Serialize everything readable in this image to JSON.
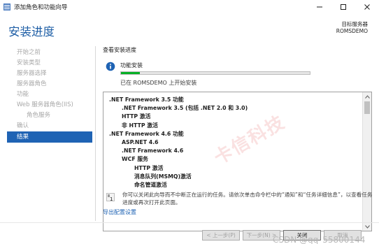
{
  "window": {
    "title": "添加角色和功能向导",
    "controls": [
      "minimize",
      "maximize",
      "close"
    ]
  },
  "header": {
    "page_title": "安装进度",
    "destination_label": "目标服务器",
    "destination_server": "ROMSDEMO"
  },
  "nav": {
    "items": [
      {
        "label": "开始之前",
        "state": "disabled"
      },
      {
        "label": "安装类型",
        "state": "disabled"
      },
      {
        "label": "服务器选择",
        "state": "disabled"
      },
      {
        "label": "服务器角色",
        "state": "disabled"
      },
      {
        "label": "功能",
        "state": "disabled"
      },
      {
        "label": "Web 服务器角色(IIS)",
        "state": "disabled"
      },
      {
        "label": "角色服务",
        "state": "disabled",
        "sub": true
      },
      {
        "label": "确认",
        "state": "disabled"
      },
      {
        "label": "结果",
        "state": "active"
      }
    ]
  },
  "main": {
    "section_label": "查看安装进度",
    "info_icon": "info-icon",
    "info_title": "功能安装",
    "progress": 0.1,
    "progress_status": "已在 ROMSDEMO 上开始安装",
    "features": [
      {
        "text": ".NET Framework 3.5 功能",
        "level": 0
      },
      {
        "text": ".NET Framework 3.5 (包括 .NET 2.0 和 3.0)",
        "level": 1
      },
      {
        "text": "HTTP 激活",
        "level": 1
      },
      {
        "text": "非 HTTP 激活",
        "level": 1
      },
      {
        "text": ".NET Framework 4.6 功能",
        "level": 0
      },
      {
        "text": "ASP.NET 4.6",
        "level": 1
      },
      {
        "text": ".NET Framework 4.6",
        "level": 1
      },
      {
        "text": "WCF 服务",
        "level": 1
      },
      {
        "text": "HTTP 激活",
        "level": 2
      },
      {
        "text": "消息队列(MSMQ)激活",
        "level": 2
      },
      {
        "text": "命名管道激活",
        "level": 2
      }
    ],
    "notice_number": "1",
    "notice_text": "你可以关闭此向导而不中断正在运行的任务。请依次单击命令栏中的“通知”和“任务详细信息”，以查看任务进度或再次打开此页面。",
    "export_link": "导出配置设置"
  },
  "buttons": {
    "prev": "< 上一步(P)",
    "next": "下一步(N) >",
    "close": "关闭",
    "cancel": "取消"
  },
  "watermark": "CSDN @qq_55800144",
  "stamp": "卡信科技",
  "colors": {
    "accent": "#1f63b4",
    "title": "#1f5fa6",
    "progress": "#06b025"
  }
}
